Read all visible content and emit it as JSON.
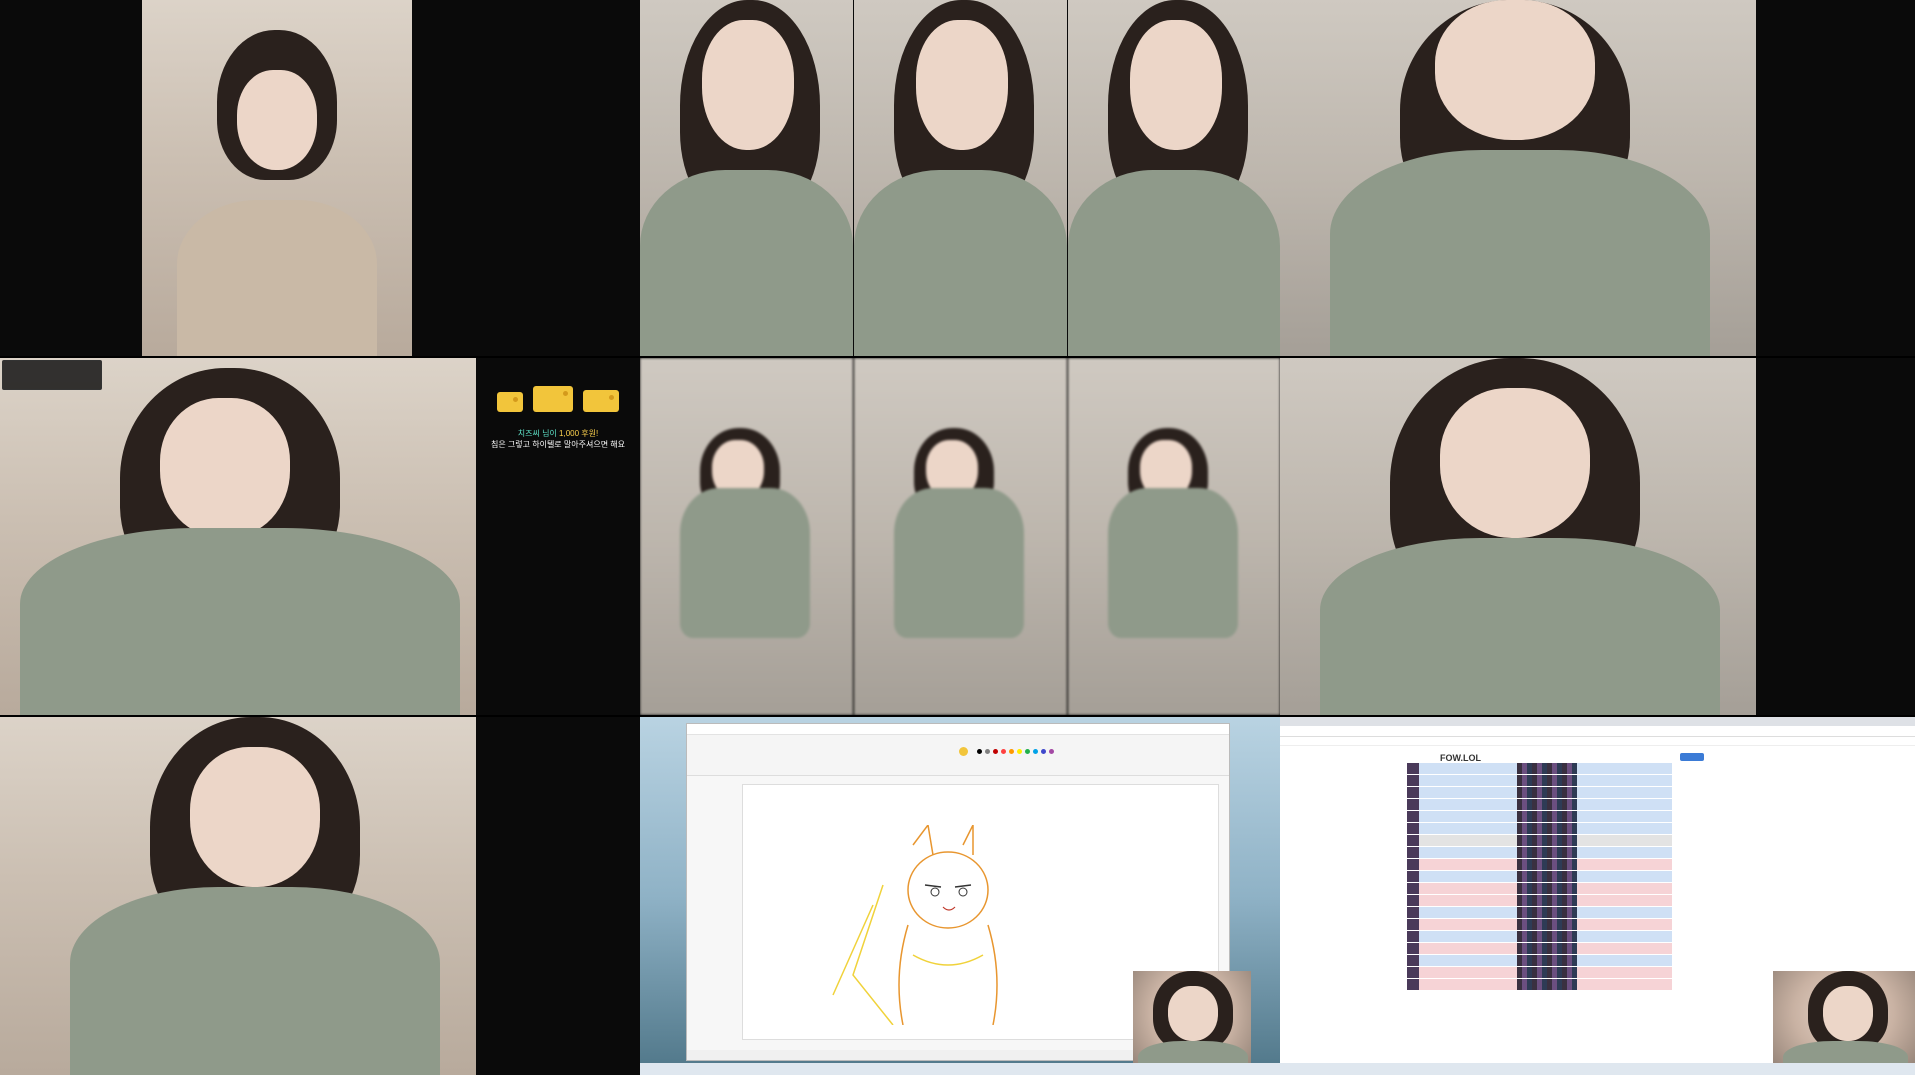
{
  "tiles": {
    "r1c1": {
      "chat": [
        {
          "user": "",
          "text": ""
        },
        {
          "user": "",
          "text": ""
        },
        {
          "user": "",
          "text": ""
        },
        {
          "user": "",
          "text": ""
        },
        {
          "user": "",
          "text": ""
        },
        {
          "user": "",
          "text": ""
        }
      ]
    },
    "r1c4": {
      "chat": [
        {
          "user": "",
          "text": ""
        },
        {
          "user": "",
          "text": ""
        },
        {
          "user": "",
          "text": ""
        },
        {
          "user": "",
          "text": ""
        },
        {
          "user": "",
          "text": ""
        },
        {
          "user": "",
          "text": ""
        }
      ]
    },
    "r2c1": {
      "badge_line1": "",
      "badge_line2": "",
      "badge_viewers": "",
      "badge_time": "",
      "donation_user": "치즈씨 님이",
      "donation_amount": "1,000 후원!",
      "donation_message": "침은 그렇고 하이텔로 말아주셔으면 해요",
      "chat": [
        {
          "user": "",
          "text": ""
        },
        {
          "user": "",
          "text": ""
        },
        {
          "user": "",
          "text": ""
        },
        {
          "user": "",
          "text": ""
        },
        {
          "user": "",
          "text": ""
        }
      ]
    },
    "r2c4": {
      "chat": [
        {
          "user": "",
          "text": ""
        },
        {
          "user": "",
          "text": ""
        },
        {
          "user": "",
          "text": ""
        },
        {
          "user": "",
          "text": ""
        },
        {
          "user": "",
          "text": ""
        }
      ]
    },
    "r3c1": {
      "chat": [
        {
          "user": "",
          "text": ""
        },
        {
          "user": "",
          "text": ""
        },
        {
          "user": "",
          "text": ""
        },
        {
          "user": "",
          "text": ""
        },
        {
          "user": "",
          "text": ""
        },
        {
          "user": "",
          "text": ""
        },
        {
          "user": "",
          "text": ""
        }
      ]
    },
    "r3c2": {
      "paint_title": "",
      "paint_status": ""
    },
    "r3c4": {
      "site_logo": "FOW.LOL"
    }
  },
  "colors": {
    "background": "#000000",
    "shirt": "#8f9a8a",
    "hair": "#2a211d",
    "cheese": "#f2c53b"
  }
}
